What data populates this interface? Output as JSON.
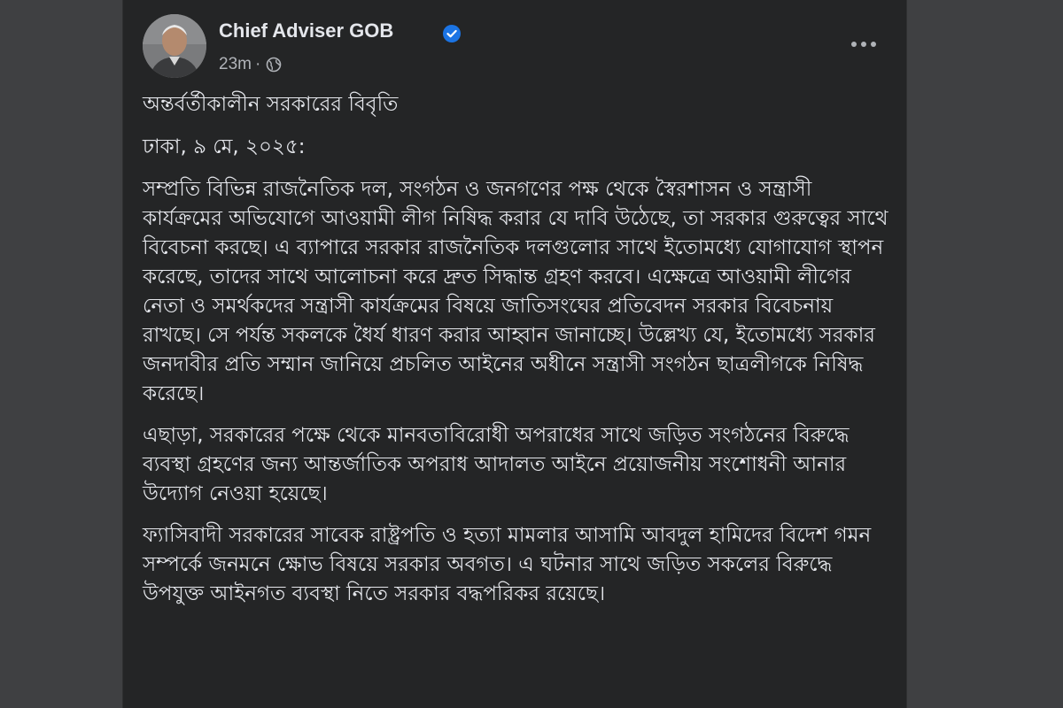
{
  "post": {
    "author": "Chief Adviser GOB",
    "time": "23m",
    "separator": "·",
    "title": "অন্তর্বর্তীকালীন সরকারের বিবৃতি",
    "dateline": "ঢাকা, ৯ মে, ২০২৫:",
    "paragraphs": [
      "সম্প্রতি বিভিন্ন রাজনৈতিক দল, সংগঠন ও জনগণের পক্ষ থেকে স্বৈরশাসন ও সন্ত্রাসী কার্যক্রমের অভিযোগে আওয়ামী লীগ নিষিদ্ধ করার যে দাবি উঠেছে, তা সরকার গুরুত্বের সাথে বিবেচনা করছে। এ ব্যাপারে সরকার রাজনৈতিক দলগুলোর সাথে ইতোমধ্যে যোগাযোগ স্থাপন করেছে, তাদের সাথে আলোচনা করে দ্রুত সিদ্ধান্ত গ্রহণ করবে। এক্ষেত্রে আওয়ামী লীগের নেতা ও সমর্থকদের সন্ত্রাসী কার্যক্রমের বিষয়ে জাতিসংঘের প্রতিবেদন সরকার বিবেচনায় রাখছে। সে পর্যন্ত সকলকে ধৈর্য ধারণ করার আহ্বান জানাচ্ছে। উল্লেখ্য যে, ইতোমধ্যে সরকার জনদাবীর প্রতি সম্মান জানিয়ে প্রচলিত আইনের অধীনে সন্ত্রাসী সংগঠন ছাত্রলীগকে নিষিদ্ধ করেছে।",
      "এছাড়া, সরকারের পক্ষে থেকে মানবতাবিরোধী অপরাধের সাথে জড়িত সংগঠনের বিরুদ্ধে ব্যবস্থা গ্রহণের জন্য আন্তর্জাতিক অপরাধ আদালত আইনে প্রয়োজনীয় সংশোধনী আনার উদ্যোগ নেওয়া হয়েছে।",
      "ফ্যাসিবাদী সরকারের সাবেক রাষ্ট্রপতি ও হত্যা মামলার আসামি আবদুল হামিদের বিদেশ গমন সম্পর্কে জনমনে ক্ষোভ বিষয়ে সরকার অবগত। এ ঘটনার সাথে জড়িত সকলের বিরুদ্ধে উপযুক্ত আইনগত ব্যবস্থা নিতে সরকার বদ্ধপরিকর রয়েছে।"
    ]
  },
  "icons": {
    "verified": "verified-badge-icon",
    "privacy": "globe-icon",
    "menu": "more-options-icon"
  },
  "colors": {
    "card_background": "#242526",
    "page_background": "#3f4042",
    "primary_text": "#e4e6eb",
    "secondary_text": "#b0b3b8",
    "verified_blue": "#1b74e4"
  }
}
